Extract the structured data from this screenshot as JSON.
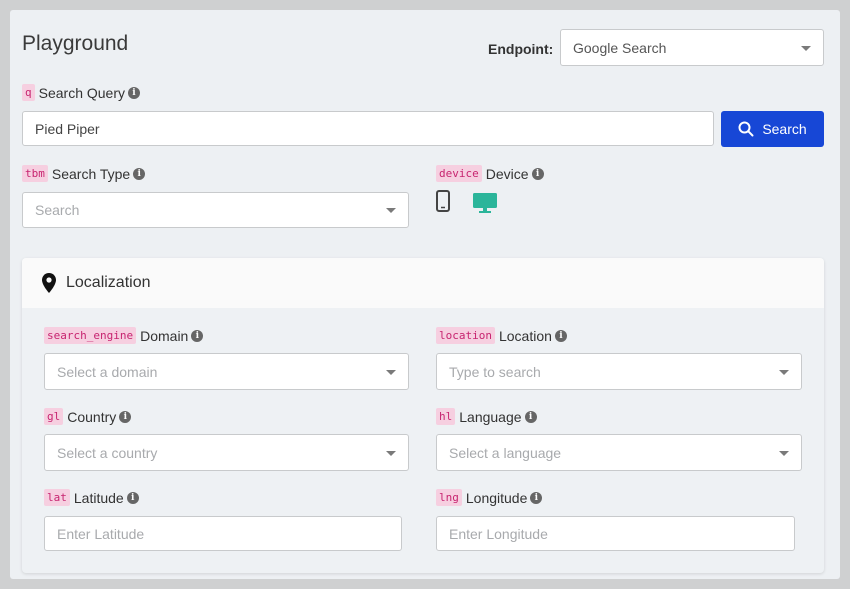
{
  "title": "Playground",
  "endpoint": {
    "label": "Endpoint:",
    "value": "Google Search"
  },
  "query": {
    "param": "q",
    "label": "Search Query",
    "value": "Pied Piper"
  },
  "search_button": {
    "label": "Search",
    "icon": "search-icon"
  },
  "search_type": {
    "param": "tbm",
    "label": "Search Type",
    "placeholder": "Search"
  },
  "device": {
    "param": "device",
    "label": "Device",
    "options": [
      "mobile-icon",
      "desktop-icon"
    ],
    "selected": "desktop",
    "selected_color": "#2bb59a"
  },
  "localization": {
    "title": "Localization",
    "domain": {
      "param": "search_engine",
      "label": "Domain",
      "placeholder": "Select a domain"
    },
    "location": {
      "param": "location",
      "label": "Location",
      "placeholder": "Type to search"
    },
    "country": {
      "param": "gl",
      "label": "Country",
      "placeholder": "Select a country"
    },
    "language": {
      "param": "hl",
      "label": "Language",
      "placeholder": "Select a language"
    },
    "latitude": {
      "param": "lat",
      "label": "Latitude",
      "placeholder": "Enter Latitude"
    },
    "longitude": {
      "param": "lng",
      "label": "Longitude",
      "placeholder": "Enter Longitude"
    }
  },
  "colors": {
    "accent": "#1747d6",
    "code_bg": "#f6cfe0",
    "code_fg": "#c72470"
  }
}
